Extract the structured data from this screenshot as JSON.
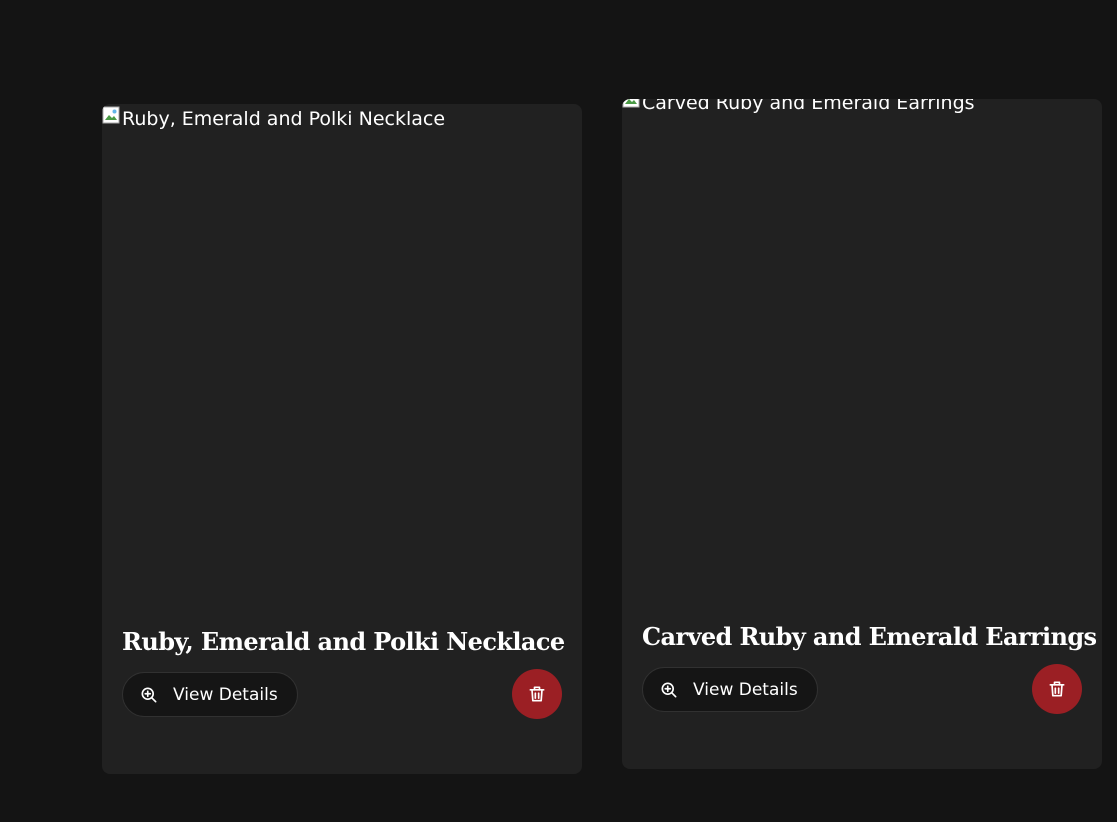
{
  "colors": {
    "page_background": "#141414",
    "card_background": "#212121",
    "button_background": "#151515",
    "delete_background": "#9b1f24",
    "text": "#ffffff"
  },
  "cards": [
    {
      "image_alt": "Ruby, Emerald and Polki Necklace",
      "title": "Ruby, Emerald and Polki Necklace",
      "view_button": {
        "label": "View Details",
        "icon": "zoom-in-icon"
      },
      "delete_button": {
        "icon": "trash-icon"
      }
    },
    {
      "image_alt": "Carved Ruby and Emerald Earrings",
      "title": "Carved Ruby and Emerald Earrings",
      "view_button": {
        "label": "View Details",
        "icon": "zoom-in-icon"
      },
      "delete_button": {
        "icon": "trash-icon"
      }
    }
  ]
}
